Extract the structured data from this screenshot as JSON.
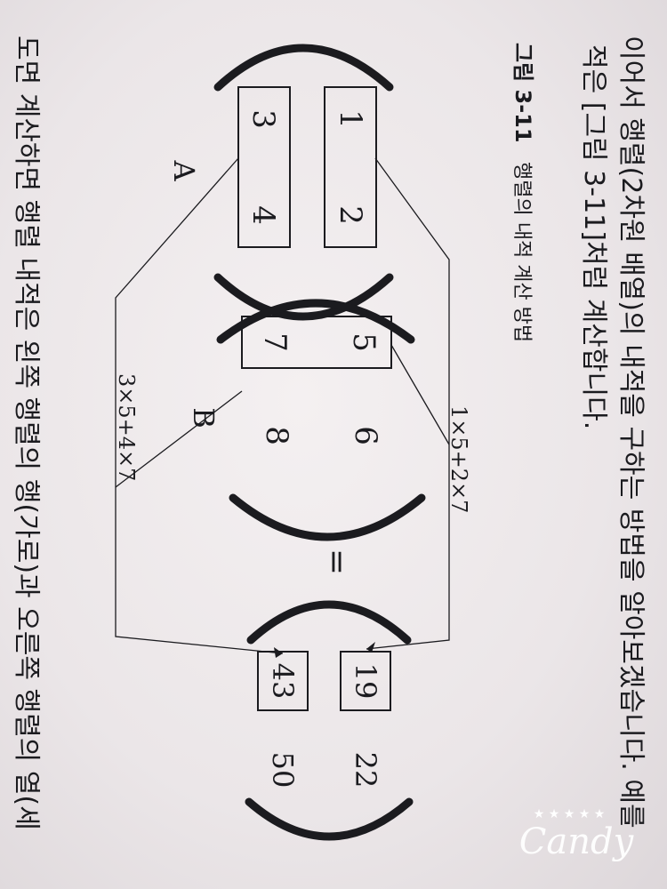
{
  "page_text": {
    "line1": "이어서 행렬(2차원 배열)의 내적을 구하는 방법을 알아보겠습니다. 예를",
    "line2": "적은 [그림 3-11]처럼 계산합니다.",
    "bottom_line": "도면 계산하면 행렬 내적은 왼쪽 행렬의 행(가로)과 오른쪽 행렬의 열(세"
  },
  "figure": {
    "number": "그림 3-11",
    "caption": "행렬의 내적 계산 방법",
    "matrix_a": {
      "label": "A",
      "row1": [
        "1",
        "2"
      ],
      "row2": [
        "3",
        "4"
      ]
    },
    "matrix_b": {
      "label": "B",
      "col1": [
        "5",
        "7"
      ],
      "col2": [
        "6",
        "8"
      ]
    },
    "equals": "=",
    "result": {
      "row1": [
        "19",
        "22"
      ],
      "row2": [
        "43",
        "50"
      ]
    },
    "formula1": "1×5+2×7",
    "formula2": "3×5+4×7"
  },
  "watermark": "Candy"
}
